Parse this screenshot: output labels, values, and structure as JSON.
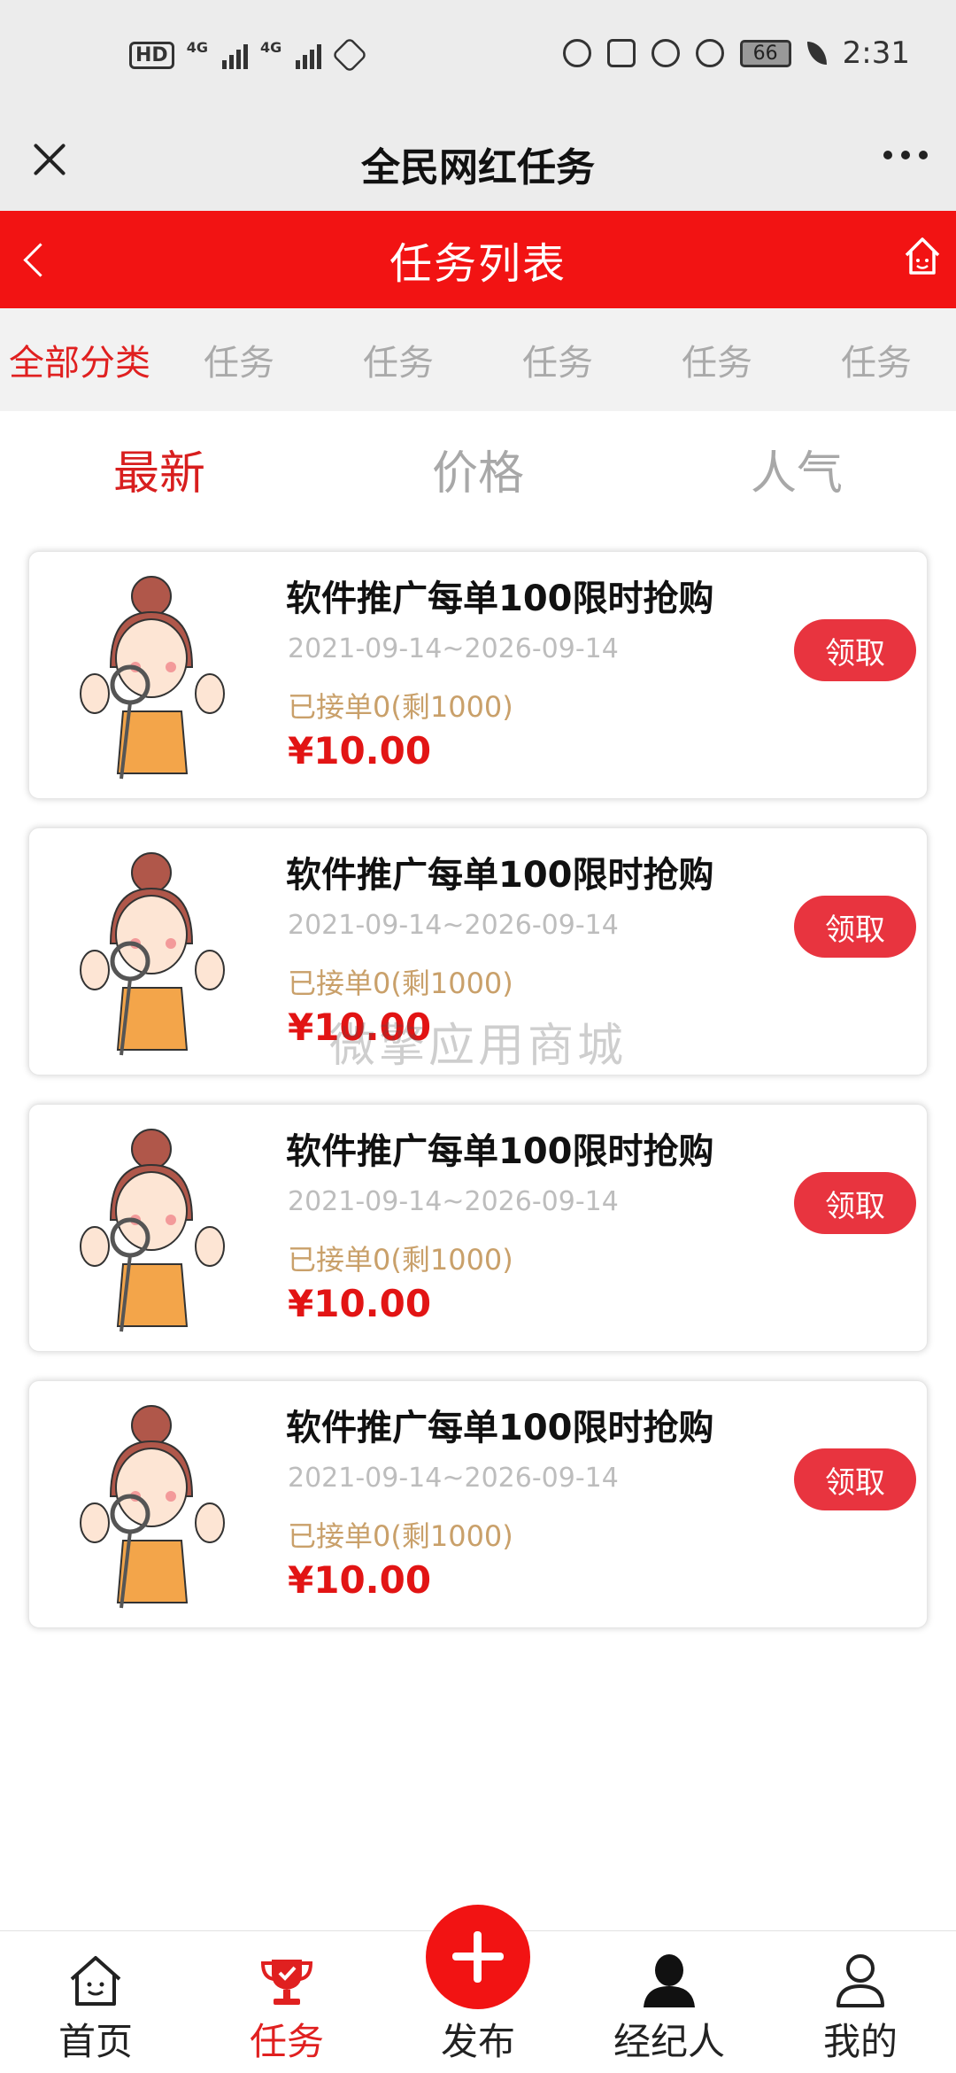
{
  "status_bar": {
    "left_indicators": [
      "HD",
      "4G",
      "4G"
    ],
    "battery": "66",
    "time": "2:31"
  },
  "title_bar": {
    "title": "全民网红任务"
  },
  "header": {
    "title": "任务列表"
  },
  "categories": [
    "全部分类",
    "任务",
    "任务",
    "任务",
    "任务",
    "任务"
  ],
  "sort_tabs": [
    "最新",
    "价格",
    "人气"
  ],
  "tasks": [
    {
      "title": "软件推广每单100限时抢购",
      "date": "2021-09-14~2026-09-14",
      "taken": "已接单0(剩1000)",
      "price": "¥10.00",
      "button": "领取"
    },
    {
      "title": "软件推广每单100限时抢购",
      "date": "2021-09-14~2026-09-14",
      "taken": "已接单0(剩1000)",
      "price": "¥10.00",
      "button": "领取"
    },
    {
      "title": "软件推广每单100限时抢购",
      "date": "2021-09-14~2026-09-14",
      "taken": "已接单0(剩1000)",
      "price": "¥10.00",
      "button": "领取"
    },
    {
      "title": "软件推广每单100限时抢购",
      "date": "2021-09-14~2026-09-14",
      "taken": "已接单0(剩1000)",
      "price": "¥10.00",
      "button": "领取"
    }
  ],
  "watermark": "微擎应用商城",
  "bottom_nav": [
    {
      "label": "首页",
      "icon": "home-icon"
    },
    {
      "label": "任务",
      "icon": "trophy-icon"
    },
    {
      "label": "发布",
      "icon": "plus-icon"
    },
    {
      "label": "经纪人",
      "icon": "agent-icon"
    },
    {
      "label": "我的",
      "icon": "user-icon"
    }
  ],
  "colors": {
    "brand_red": "#f21313",
    "accent_red": "#e02020",
    "button_red": "#e8343f",
    "gold": "#c9a06a"
  }
}
